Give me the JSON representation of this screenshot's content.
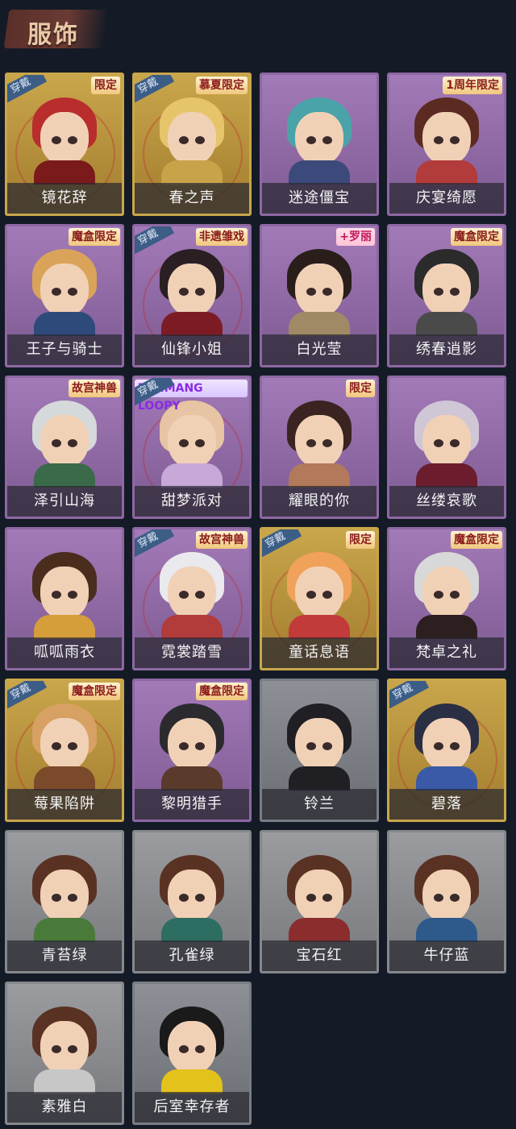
{
  "header": {
    "title": "服饰"
  },
  "cards": [
    {
      "label": "镜花辞",
      "frame": "gold",
      "equipped": true,
      "badge": "限定",
      "badge_style": "",
      "hair": "#b92d2d",
      "outfit": "#7a1a1a"
    },
    {
      "label": "春之声",
      "frame": "gold",
      "equipped": true,
      "badge": "慕夏限定",
      "badge_style": "",
      "hair": "#e6c46a",
      "outfit": "#c9a34a"
    },
    {
      "label": "迷途僵宝",
      "frame": "purple",
      "equipped": false,
      "badge": "",
      "badge_style": "",
      "hair": "#4aa3a8",
      "outfit": "#3b4a7a"
    },
    {
      "label": "庆宴绮愿",
      "frame": "purple",
      "equipped": false,
      "badge": "1周年限定",
      "badge_style": "",
      "hair": "#5b2b22",
      "outfit": "#b23b3b"
    },
    {
      "label": "王子与骑士",
      "frame": "purple",
      "equipped": false,
      "badge": "魔盒限定",
      "badge_style": "",
      "hair": "#d9a45a",
      "outfit": "#2e4a7a"
    },
    {
      "label": "仙锋小姐",
      "frame": "purple",
      "equipped": true,
      "badge": "非遗雏戏",
      "badge_style": "",
      "hair": "#2a1f23",
      "outfit": "#7d1b25"
    },
    {
      "label": "白光莹",
      "frame": "purple",
      "equipped": false,
      "badge": "+罗丽",
      "badge_style": "pink",
      "hair": "#2a1e1a",
      "outfit": "#a08a66"
    },
    {
      "label": "绣春逍影",
      "frame": "purple",
      "equipped": false,
      "badge": "魔盒限定",
      "badge_style": "",
      "hair": "#2b2b2b",
      "outfit": "#4a4a4a"
    },
    {
      "label": "泽引山海",
      "frame": "purple",
      "equipped": false,
      "badge": "故宫神兽",
      "badge_style": "",
      "hair": "#d5d9d9",
      "outfit": "#3b6a4a"
    },
    {
      "label": "甜梦派对",
      "frame": "purple",
      "equipped": true,
      "badge": "ZANMANG LOOPY",
      "badge_style": "blue",
      "hair": "#e7c4a3",
      "outfit": "#c8a7d9"
    },
    {
      "label": "耀眼的你",
      "frame": "purple",
      "equipped": false,
      "badge": "限定",
      "badge_style": "",
      "hair": "#3a2320",
      "outfit": "#b27a5a"
    },
    {
      "label": "丝缕哀歌",
      "frame": "purple",
      "equipped": false,
      "badge": "",
      "badge_style": "",
      "hair": "#cfc6d6",
      "outfit": "#6b1d2d"
    },
    {
      "label": "呱呱雨衣",
      "frame": "purple",
      "equipped": false,
      "badge": "",
      "badge_style": "",
      "hair": "#4a2d1d",
      "outfit": "#d69d3b"
    },
    {
      "label": "霓裳踏雪",
      "frame": "purple",
      "equipped": true,
      "badge": "故宫神兽",
      "badge_style": "",
      "hair": "#e9e9ee",
      "outfit": "#b23b3b"
    },
    {
      "label": "童话息语",
      "frame": "gold",
      "equipped": true,
      "badge": "限定",
      "badge_style": "",
      "hair": "#f0a15a",
      "outfit": "#c33a3a"
    },
    {
      "label": "梵卓之礼",
      "frame": "purple",
      "equipped": false,
      "badge": "魔盒限定",
      "badge_style": "",
      "hair": "#d8d8d8",
      "outfit": "#2d1f1f"
    },
    {
      "label": "莓果陷阱",
      "frame": "gold",
      "equipped": true,
      "badge": "魔盒限定",
      "badge_style": "",
      "hair": "#d7a163",
      "outfit": "#7a4a2b"
    },
    {
      "label": "黎明猎手",
      "frame": "purple",
      "equipped": false,
      "badge": "魔盒限定",
      "badge_style": "",
      "hair": "#2b2b2f",
      "outfit": "#5a3a2b"
    },
    {
      "label": "铃兰",
      "frame": "gray",
      "equipped": false,
      "badge": "",
      "badge_style": "",
      "hair": "#1f1f24",
      "outfit": "#1f1f24"
    },
    {
      "label": "碧落",
      "frame": "gold",
      "equipped": true,
      "badge": "",
      "badge_style": "",
      "hair": "#2b2f44",
      "outfit": "#3a5aa8"
    },
    {
      "label": "青苔绿",
      "frame": "lightgray",
      "equipped": false,
      "badge": "",
      "badge_style": "",
      "hair": "#5a3224",
      "outfit": "#4a7a3a"
    },
    {
      "label": "孔雀绿",
      "frame": "lightgray",
      "equipped": false,
      "badge": "",
      "badge_style": "",
      "hair": "#5a3224",
      "outfit": "#2e6e62"
    },
    {
      "label": "宝石红",
      "frame": "lightgray",
      "equipped": false,
      "badge": "",
      "badge_style": "",
      "hair": "#5a3224",
      "outfit": "#8b2d2d"
    },
    {
      "label": "牛仔蓝",
      "frame": "lightgray",
      "equipped": false,
      "badge": "",
      "badge_style": "",
      "hair": "#5a3224",
      "outfit": "#2d5a8b"
    },
    {
      "label": "素雅白",
      "frame": "lightgray",
      "equipped": false,
      "badge": "",
      "badge_style": "",
      "hair": "#5a3224",
      "outfit": "#c7c7c7"
    },
    {
      "label": "后室幸存者",
      "frame": "gray",
      "equipped": false,
      "badge": "",
      "badge_style": "",
      "hair": "#1a1a1a",
      "outfit": "#e3c21b"
    }
  ],
  "equipped_text": "穿戴"
}
